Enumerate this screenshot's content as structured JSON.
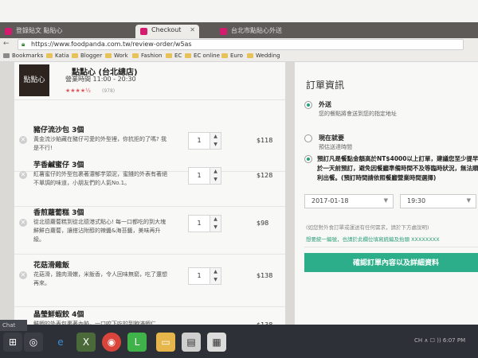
{
  "browser": {
    "tabs": [
      {
        "label": "登錄貼文 點貼心"
      },
      {
        "label": "Checkout"
      },
      {
        "label": "台北市點貼心外送"
      }
    ],
    "url": "https://www.foodpanda.com.tw/review-order/w5as",
    "bookmarks": [
      "Bookmarks",
      "Katia",
      "Blogger",
      "Work",
      "Fashion",
      "EC",
      "EC online",
      "Euro",
      "Wedding"
    ],
    "accent_color": "#d51b6f"
  },
  "restaurant": {
    "name": "點點心 (台北總店)",
    "hours": "營業時間 11:00 - 20:30",
    "logo_text": "點點心",
    "stars": "★★★★½",
    "rating_count": "(978)"
  },
  "cart": {
    "items": [
      {
        "name": "豬仔流沙包 3個",
        "desc": "黃金流沙餡藏在豬仔可愛的外型裡，你抗拒的了嗎? 我是不行!",
        "qty": "1",
        "price": "$118"
      },
      {
        "name": "芋香鹹蜜仔 3個",
        "desc": "紅薯蜜仔的外型包裹著濃郁芋頭泥，蜜餞的外表有著絕不單調的味道，小朋友們的人氣No.1。",
        "qty": "1",
        "price": "$128"
      },
      {
        "name": "香煎蘿蔔糕 3個",
        "desc": "從北德蘿蔔糕到從北德港式點心! 每一口都吃的到大塊鮮鮮白蘿蔔，讓搭沾附醇的辣醬&海苔醬，美味再升級。",
        "qty": "1",
        "price": "$98"
      },
      {
        "name": "花菇滑雞飯",
        "desc": "花菇滑，雞肉滑嫩，米飯香，令人回味無窮，吃了還想再來。",
        "qty": "1",
        "price": "$138"
      },
      {
        "name": "晶瑩鮮蝦餃 4個",
        "desc": "鮮蝦的外表包裹著內餡，一口咬下吃的到飽滿蝦仁",
        "qty": "1",
        "price": "$138"
      }
    ],
    "remove_icon": "close-circle-icon",
    "stepper_up": "▲",
    "stepper_down": "▼"
  },
  "order_panel": {
    "title": "訂單資訊",
    "options": [
      {
        "label": "外送",
        "sub": "您的餐點將會送到您的指定地址",
        "selected": true
      },
      {
        "label": "現在就要",
        "sub": "預估送達時間",
        "selected": false
      },
      {
        "label": "預訂凡是餐點金額高於NT$4000以上訂單，建議您至少提早於一天前預訂，避免因餐廳準備時間不及等臨時狀況，無法順利出餐。(預訂時間請依照餐廳營業時間選擇)",
        "sub": "",
        "selected": true
      }
    ],
    "date": "2017-01-18",
    "time": "19:30",
    "note": "(如您對外食訂單或運送有任何需求，請於下方處說明)",
    "link": "想要統一編號，也請於此欄位填寫統編及抬頭 XXXXXXXX",
    "confirm_label": "確認訂單內容以及詳細資料",
    "accent_color": "#2bae89"
  },
  "taskbar": {
    "chat_label": "Chat",
    "tray_text": "CH  ∧  ☐  ))  6:07 PM"
  }
}
